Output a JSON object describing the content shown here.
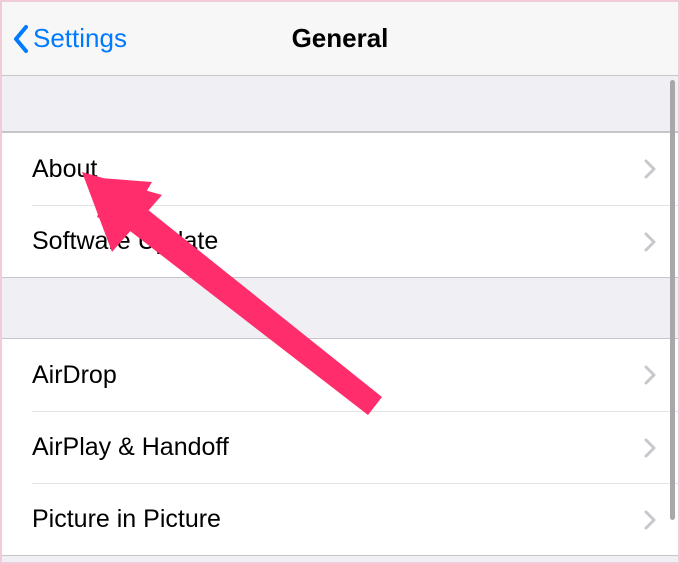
{
  "header": {
    "back_label": "Settings",
    "title": "General"
  },
  "groups": [
    {
      "items": [
        {
          "label": "About"
        },
        {
          "label": "Software Update"
        }
      ]
    },
    {
      "items": [
        {
          "label": "AirDrop"
        },
        {
          "label": "AirPlay & Handoff"
        },
        {
          "label": "Picture in Picture"
        }
      ]
    }
  ],
  "colors": {
    "accent": "#007aff",
    "annotation": "#ff2d6b"
  }
}
